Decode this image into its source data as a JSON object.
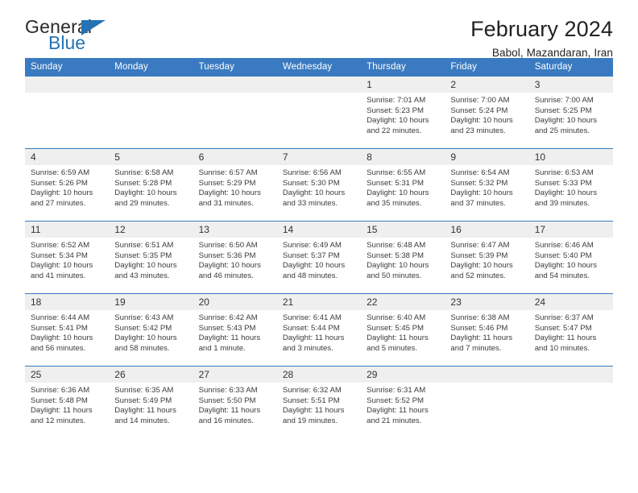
{
  "brand": {
    "name_part1": "General",
    "name_part2": "Blue",
    "accent_color": "#2573b5"
  },
  "header": {
    "title": "February 2024",
    "subtitle": "Babol, Mazandaran, Iran"
  },
  "theme": {
    "header_row_bg": "#3a7ac0",
    "daynum_bg": "#efefef",
    "grid_line": "#3a7ac0",
    "text": "#3b3b3b"
  },
  "calendar": {
    "weekday_headers": [
      "Sunday",
      "Monday",
      "Tuesday",
      "Wednesday",
      "Thursday",
      "Friday",
      "Saturday"
    ],
    "weeks": [
      [
        {
          "day": "",
          "blank": true,
          "sunrise": "",
          "sunset": "",
          "daylight_line1": "",
          "daylight_line2": ""
        },
        {
          "day": "",
          "blank": true,
          "sunrise": "",
          "sunset": "",
          "daylight_line1": "",
          "daylight_line2": ""
        },
        {
          "day": "",
          "blank": true,
          "sunrise": "",
          "sunset": "",
          "daylight_line1": "",
          "daylight_line2": ""
        },
        {
          "day": "",
          "blank": true,
          "sunrise": "",
          "sunset": "",
          "daylight_line1": "",
          "daylight_line2": ""
        },
        {
          "day": "1",
          "blank": false,
          "sunrise": "Sunrise: 7:01 AM",
          "sunset": "Sunset: 5:23 PM",
          "daylight_line1": "Daylight: 10 hours",
          "daylight_line2": "and 22 minutes."
        },
        {
          "day": "2",
          "blank": false,
          "sunrise": "Sunrise: 7:00 AM",
          "sunset": "Sunset: 5:24 PM",
          "daylight_line1": "Daylight: 10 hours",
          "daylight_line2": "and 23 minutes."
        },
        {
          "day": "3",
          "blank": false,
          "sunrise": "Sunrise: 7:00 AM",
          "sunset": "Sunset: 5:25 PM",
          "daylight_line1": "Daylight: 10 hours",
          "daylight_line2": "and 25 minutes."
        }
      ],
      [
        {
          "day": "4",
          "blank": false,
          "sunrise": "Sunrise: 6:59 AM",
          "sunset": "Sunset: 5:26 PM",
          "daylight_line1": "Daylight: 10 hours",
          "daylight_line2": "and 27 minutes."
        },
        {
          "day": "5",
          "blank": false,
          "sunrise": "Sunrise: 6:58 AM",
          "sunset": "Sunset: 5:28 PM",
          "daylight_line1": "Daylight: 10 hours",
          "daylight_line2": "and 29 minutes."
        },
        {
          "day": "6",
          "blank": false,
          "sunrise": "Sunrise: 6:57 AM",
          "sunset": "Sunset: 5:29 PM",
          "daylight_line1": "Daylight: 10 hours",
          "daylight_line2": "and 31 minutes."
        },
        {
          "day": "7",
          "blank": false,
          "sunrise": "Sunrise: 6:56 AM",
          "sunset": "Sunset: 5:30 PM",
          "daylight_line1": "Daylight: 10 hours",
          "daylight_line2": "and 33 minutes."
        },
        {
          "day": "8",
          "blank": false,
          "sunrise": "Sunrise: 6:55 AM",
          "sunset": "Sunset: 5:31 PM",
          "daylight_line1": "Daylight: 10 hours",
          "daylight_line2": "and 35 minutes."
        },
        {
          "day": "9",
          "blank": false,
          "sunrise": "Sunrise: 6:54 AM",
          "sunset": "Sunset: 5:32 PM",
          "daylight_line1": "Daylight: 10 hours",
          "daylight_line2": "and 37 minutes."
        },
        {
          "day": "10",
          "blank": false,
          "sunrise": "Sunrise: 6:53 AM",
          "sunset": "Sunset: 5:33 PM",
          "daylight_line1": "Daylight: 10 hours",
          "daylight_line2": "and 39 minutes."
        }
      ],
      [
        {
          "day": "11",
          "blank": false,
          "sunrise": "Sunrise: 6:52 AM",
          "sunset": "Sunset: 5:34 PM",
          "daylight_line1": "Daylight: 10 hours",
          "daylight_line2": "and 41 minutes."
        },
        {
          "day": "12",
          "blank": false,
          "sunrise": "Sunrise: 6:51 AM",
          "sunset": "Sunset: 5:35 PM",
          "daylight_line1": "Daylight: 10 hours",
          "daylight_line2": "and 43 minutes."
        },
        {
          "day": "13",
          "blank": false,
          "sunrise": "Sunrise: 6:50 AM",
          "sunset": "Sunset: 5:36 PM",
          "daylight_line1": "Daylight: 10 hours",
          "daylight_line2": "and 46 minutes."
        },
        {
          "day": "14",
          "blank": false,
          "sunrise": "Sunrise: 6:49 AM",
          "sunset": "Sunset: 5:37 PM",
          "daylight_line1": "Daylight: 10 hours",
          "daylight_line2": "and 48 minutes."
        },
        {
          "day": "15",
          "blank": false,
          "sunrise": "Sunrise: 6:48 AM",
          "sunset": "Sunset: 5:38 PM",
          "daylight_line1": "Daylight: 10 hours",
          "daylight_line2": "and 50 minutes."
        },
        {
          "day": "16",
          "blank": false,
          "sunrise": "Sunrise: 6:47 AM",
          "sunset": "Sunset: 5:39 PM",
          "daylight_line1": "Daylight: 10 hours",
          "daylight_line2": "and 52 minutes."
        },
        {
          "day": "17",
          "blank": false,
          "sunrise": "Sunrise: 6:46 AM",
          "sunset": "Sunset: 5:40 PM",
          "daylight_line1": "Daylight: 10 hours",
          "daylight_line2": "and 54 minutes."
        }
      ],
      [
        {
          "day": "18",
          "blank": false,
          "sunrise": "Sunrise: 6:44 AM",
          "sunset": "Sunset: 5:41 PM",
          "daylight_line1": "Daylight: 10 hours",
          "daylight_line2": "and 56 minutes."
        },
        {
          "day": "19",
          "blank": false,
          "sunrise": "Sunrise: 6:43 AM",
          "sunset": "Sunset: 5:42 PM",
          "daylight_line1": "Daylight: 10 hours",
          "daylight_line2": "and 58 minutes."
        },
        {
          "day": "20",
          "blank": false,
          "sunrise": "Sunrise: 6:42 AM",
          "sunset": "Sunset: 5:43 PM",
          "daylight_line1": "Daylight: 11 hours",
          "daylight_line2": "and 1 minute."
        },
        {
          "day": "21",
          "blank": false,
          "sunrise": "Sunrise: 6:41 AM",
          "sunset": "Sunset: 5:44 PM",
          "daylight_line1": "Daylight: 11 hours",
          "daylight_line2": "and 3 minutes."
        },
        {
          "day": "22",
          "blank": false,
          "sunrise": "Sunrise: 6:40 AM",
          "sunset": "Sunset: 5:45 PM",
          "daylight_line1": "Daylight: 11 hours",
          "daylight_line2": "and 5 minutes."
        },
        {
          "day": "23",
          "blank": false,
          "sunrise": "Sunrise: 6:38 AM",
          "sunset": "Sunset: 5:46 PM",
          "daylight_line1": "Daylight: 11 hours",
          "daylight_line2": "and 7 minutes."
        },
        {
          "day": "24",
          "blank": false,
          "sunrise": "Sunrise: 6:37 AM",
          "sunset": "Sunset: 5:47 PM",
          "daylight_line1": "Daylight: 11 hours",
          "daylight_line2": "and 10 minutes."
        }
      ],
      [
        {
          "day": "25",
          "blank": false,
          "sunrise": "Sunrise: 6:36 AM",
          "sunset": "Sunset: 5:48 PM",
          "daylight_line1": "Daylight: 11 hours",
          "daylight_line2": "and 12 minutes."
        },
        {
          "day": "26",
          "blank": false,
          "sunrise": "Sunrise: 6:35 AM",
          "sunset": "Sunset: 5:49 PM",
          "daylight_line1": "Daylight: 11 hours",
          "daylight_line2": "and 14 minutes."
        },
        {
          "day": "27",
          "blank": false,
          "sunrise": "Sunrise: 6:33 AM",
          "sunset": "Sunset: 5:50 PM",
          "daylight_line1": "Daylight: 11 hours",
          "daylight_line2": "and 16 minutes."
        },
        {
          "day": "28",
          "blank": false,
          "sunrise": "Sunrise: 6:32 AM",
          "sunset": "Sunset: 5:51 PM",
          "daylight_line1": "Daylight: 11 hours",
          "daylight_line2": "and 19 minutes."
        },
        {
          "day": "29",
          "blank": false,
          "sunrise": "Sunrise: 6:31 AM",
          "sunset": "Sunset: 5:52 PM",
          "daylight_line1": "Daylight: 11 hours",
          "daylight_line2": "and 21 minutes."
        },
        {
          "day": "",
          "blank": true,
          "sunrise": "",
          "sunset": "",
          "daylight_line1": "",
          "daylight_line2": ""
        },
        {
          "day": "",
          "blank": true,
          "sunrise": "",
          "sunset": "",
          "daylight_line1": "",
          "daylight_line2": ""
        }
      ]
    ]
  }
}
